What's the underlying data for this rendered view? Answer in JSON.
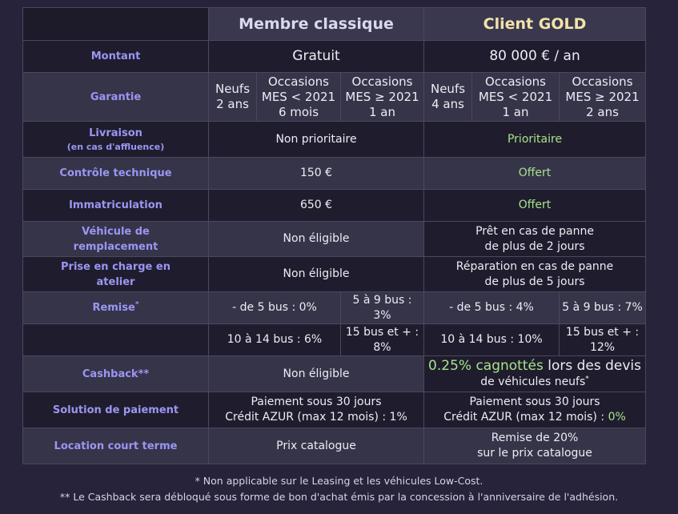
{
  "header": {
    "classic": "Membre classique",
    "gold": "Client GOLD"
  },
  "rows": {
    "montant": {
      "label": "Montant",
      "classic": "Gratuit",
      "gold": "80 000 € / an"
    },
    "garantie": {
      "label": "Garantie",
      "classic": [
        {
          "l1": "Neufs",
          "l2": "2 ans",
          "l3": ""
        },
        {
          "l1": "Occasions",
          "l2": "MES < 2021",
          "l3": "6 mois"
        },
        {
          "l1": "Occasions",
          "l2": "MES ≥ 2021",
          "l3": "1 an"
        }
      ],
      "gold": [
        {
          "l1": "Neufs",
          "l2": "4 ans",
          "l3": ""
        },
        {
          "l1": "Occasions",
          "l2": "MES < 2021",
          "l3": "1 an"
        },
        {
          "l1": "Occasions",
          "l2": "MES ≥ 2021",
          "l3": "2 ans"
        }
      ]
    },
    "livraison": {
      "label": "Livraison",
      "sublabel": "(en cas d'affluence)",
      "classic": "Non prioritaire",
      "gold": "Prioritaire"
    },
    "controle": {
      "label": "Contrôle technique",
      "classic": "150 €",
      "gold": "Offert"
    },
    "immat": {
      "label": "Immatriculation",
      "classic": "650 €",
      "gold": "Offert"
    },
    "vehicule": {
      "label_l1": "Véhicule de",
      "label_l2": "remplacement",
      "classic": "Non éligible",
      "gold_l1": "Prêt en cas de panne",
      "gold_l2": "de plus de 2 jours"
    },
    "atelier": {
      "label_l1": "Prise en charge en",
      "label_l2": "atelier",
      "classic": "Non éligible",
      "gold_l1": "Réparation en cas de panne",
      "gold_l2": "de plus de 5 jours"
    },
    "remise": {
      "label": "Remise",
      "label_mark": "*",
      "classic_1": [
        "- de 5 bus : 0%",
        "5 à 9 bus : 3%"
      ],
      "gold_1": [
        "- de 5 bus : 4%",
        "5 à 9 bus : 7%"
      ],
      "classic_2": [
        "10 à 14 bus : 6%",
        "15 bus et + : 8%"
      ],
      "gold_2": [
        "10 à 14 bus : 10%",
        "15 bus et + : 12%"
      ]
    },
    "cashback": {
      "label": "Cashback**",
      "classic": "Non éligible",
      "gold_hl": "0.25% cagnottés",
      "gold_rest": " lors des devis",
      "gold_sub": "de véhicules neufs",
      "gold_mark": "*"
    },
    "paiement": {
      "label": "Solution de paiement",
      "classic_l1": "Paiement sous 30 jours",
      "classic_l2": "Crédit AZUR (max 12 mois) : 1%",
      "gold_l1": "Paiement sous 30 jours",
      "gold_l2": "Crédit AZUR (max 12 mois) : ",
      "gold_pct": "0%"
    },
    "location": {
      "label": "Location court terme",
      "classic": "Prix catalogue",
      "gold_l1": "Remise de 20%",
      "gold_l2": "sur le prix catalogue"
    }
  },
  "footnotes": {
    "n1": "* Non applicable sur le Leasing et les véhicules Low-Cost.",
    "n2": "** Le Cashback sera débloqué sous forme de bon d'achat émis par la concession à l'anniversaire de l'adhésion."
  },
  "colors": {
    "background": "#26233a",
    "label": "#9b96f2",
    "gold_header": "#f3e2a8",
    "highlight_green": "#a7e38b"
  }
}
